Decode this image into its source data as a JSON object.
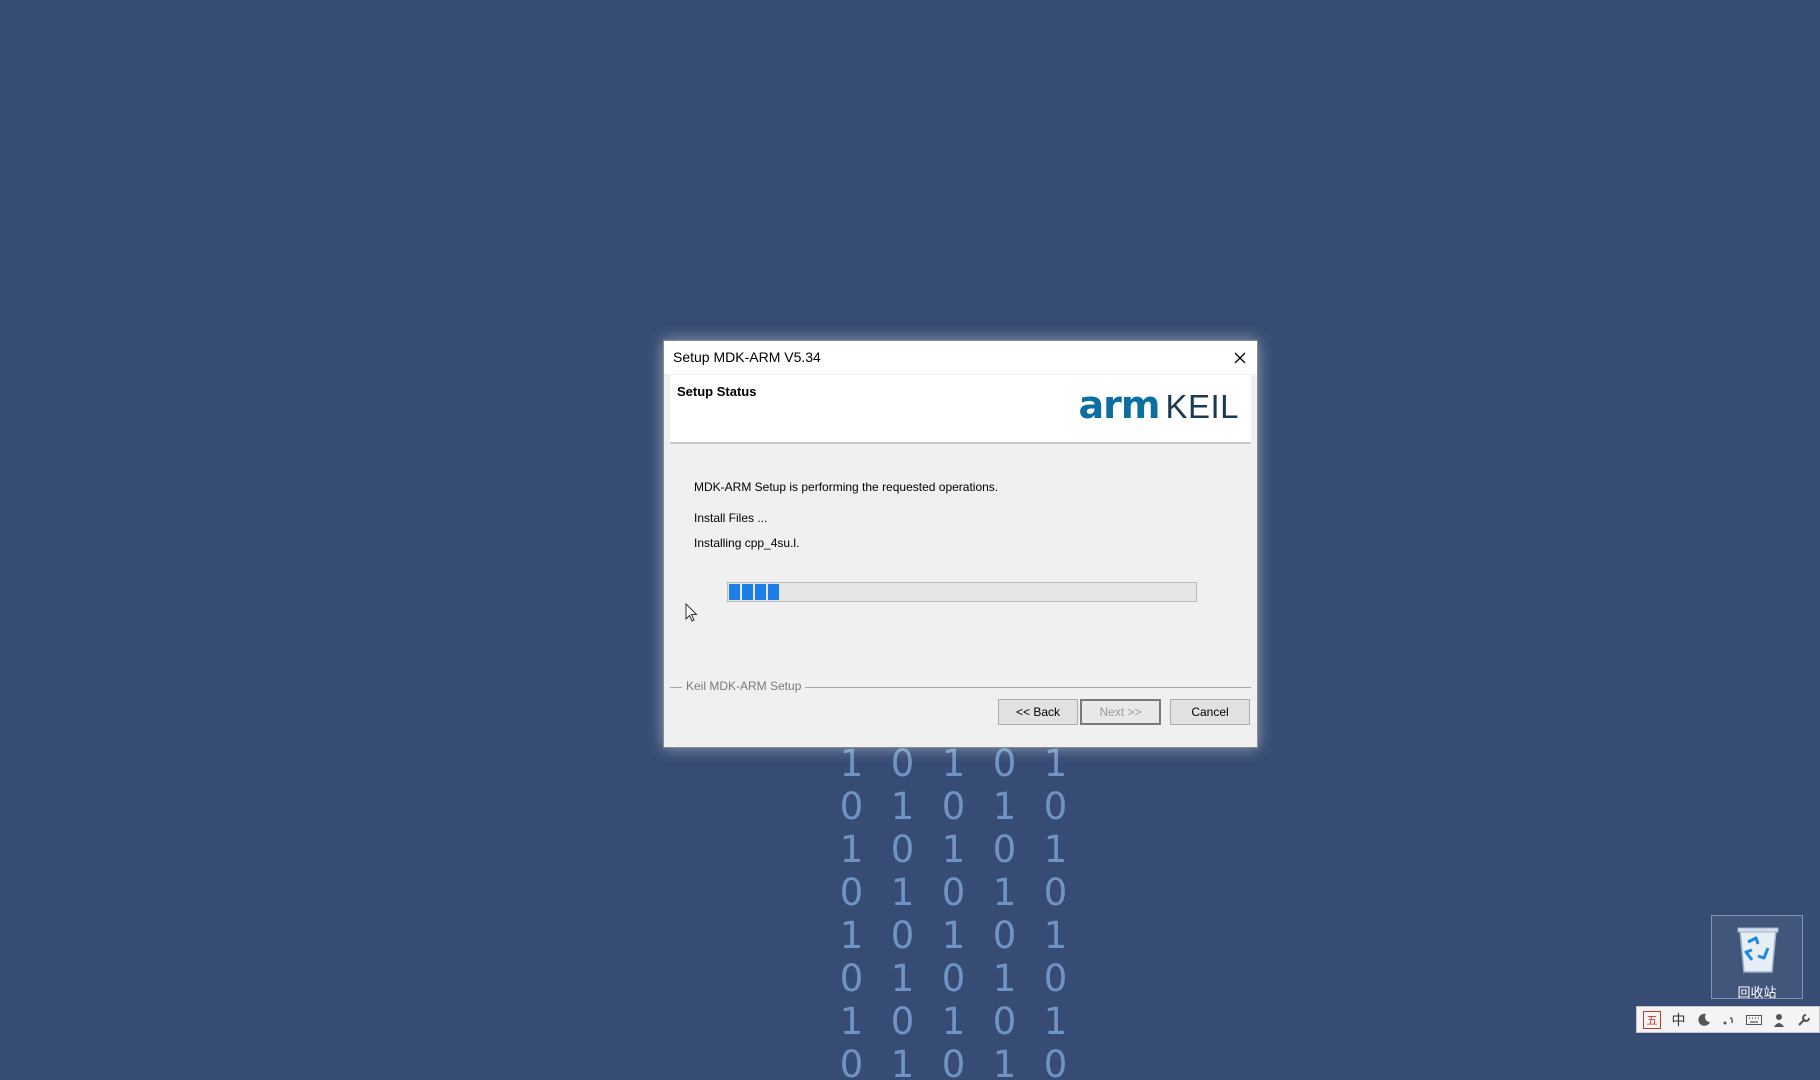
{
  "dialog": {
    "title": "Setup MDK-ARM V5.34",
    "header_title": "Setup Status",
    "logo": {
      "arm": "arm",
      "keil": "KEIL"
    },
    "message": "MDK-ARM Setup is performing the requested operations.",
    "install_label": "Install Files ...",
    "current_file": "Installing cpp_4su.l.",
    "progress_fraction": 0.11,
    "group_label": "Keil MDK-ARM Setup",
    "buttons": {
      "back": "<< Back",
      "next": "Next >>",
      "cancel": "Cancel"
    }
  },
  "desktop": {
    "binary_rows": [
      [
        "1",
        "0",
        "1",
        "0",
        "1"
      ],
      [
        "0",
        "1",
        "0",
        "1",
        "0"
      ],
      [
        "1",
        "0",
        "1",
        "0",
        "1"
      ],
      [
        "0",
        "1",
        "0",
        "1",
        "0"
      ],
      [
        "1",
        "0",
        "1",
        "0",
        "1"
      ],
      [
        "0",
        "1",
        "0",
        "1",
        "0"
      ],
      [
        "1",
        "0",
        "1",
        "0",
        "1"
      ],
      [
        "0",
        "1",
        "0",
        "1",
        "0"
      ]
    ],
    "recycle_bin_label": "回收站"
  },
  "ime_toolbar": {
    "items": [
      "五",
      "中",
      "moon-icon",
      "punctuation-icon",
      "keyboard-icon",
      "user-icon",
      "wrench-icon"
    ],
    "mode_label": "五",
    "lang_label": "中"
  },
  "colors": {
    "desktop_bg": "#374c74",
    "progress": "#1e7ee8",
    "arm_logo": "#0b6fa2"
  }
}
